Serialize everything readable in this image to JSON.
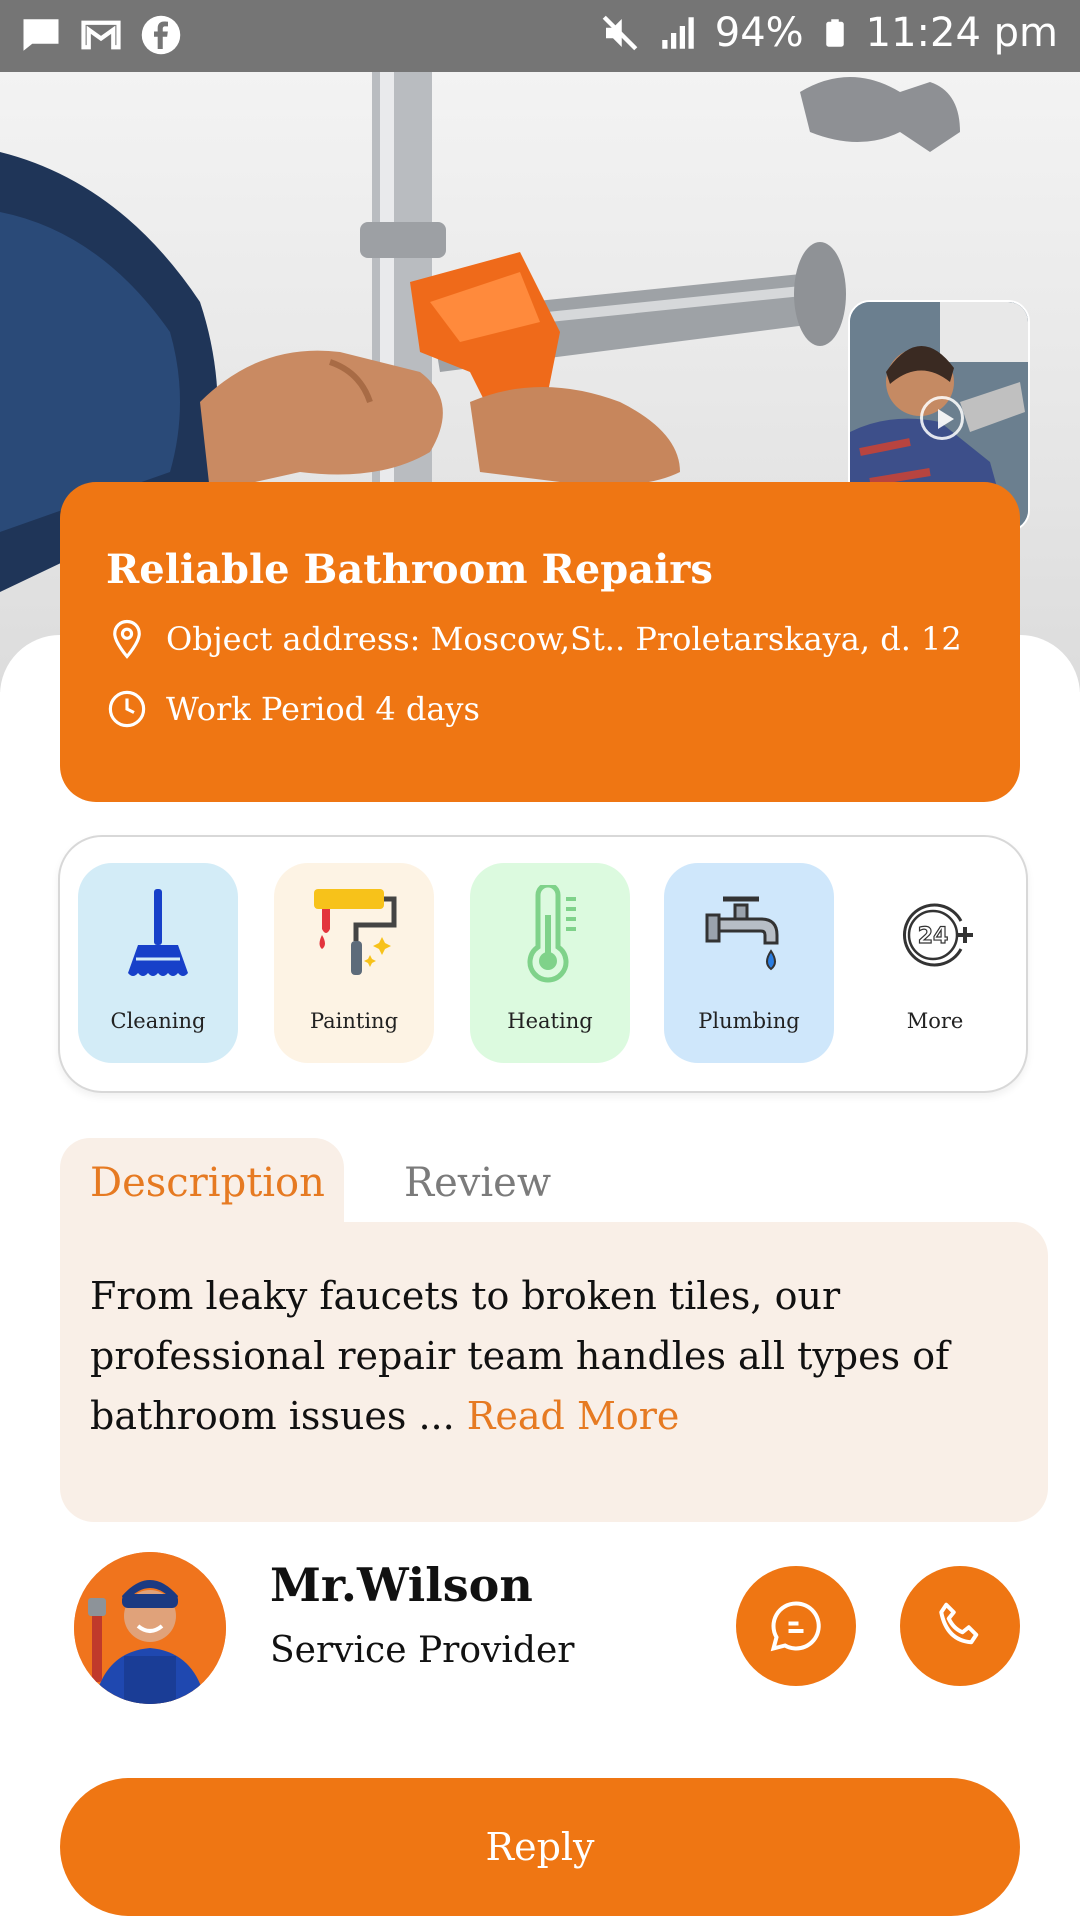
{
  "status_bar": {
    "battery": "94%",
    "time": "11:24 pm",
    "icons": [
      "message-icon",
      "gmail-icon",
      "facebook-icon",
      "mute-icon",
      "signal-icon",
      "battery-icon"
    ]
  },
  "hero": {
    "image": "plumber-wrench-pipe-photo",
    "video_thumbnail": "plumber-video-thumbnail"
  },
  "job": {
    "title": "Reliable Bathroom Repairs",
    "address": "Object address: Moscow,St.. Proletarskaya, d. 12",
    "period": "Work Period 4 days"
  },
  "services": [
    {
      "label": "Cleaning",
      "icon": "broom-icon",
      "bg": "#d3ecf7"
    },
    {
      "label": "Painting",
      "icon": "paint-roller-icon",
      "bg": "#fdf3e4"
    },
    {
      "label": "Heating",
      "icon": "thermometer-icon",
      "bg": "#dcfadf"
    },
    {
      "label": "Plumbing",
      "icon": "faucet-icon",
      "bg": "#cfe7fb"
    },
    {
      "label": "More",
      "icon": "24-hours-icon",
      "bg": "#ffffff"
    }
  ],
  "tabs": {
    "description": "Description",
    "review": "Review"
  },
  "description": {
    "text": "From leaky faucets to broken tiles, our professional repair team handles all types of bathroom issues ... ",
    "read_more": "Read More"
  },
  "provider": {
    "name": "Mr.Wilson",
    "role": "Service Provider"
  },
  "actions": {
    "reply": "Reply"
  },
  "colors": {
    "accent": "#ef7613",
    "status_bar": "#757575",
    "tab_bg": "#f9efe7"
  }
}
